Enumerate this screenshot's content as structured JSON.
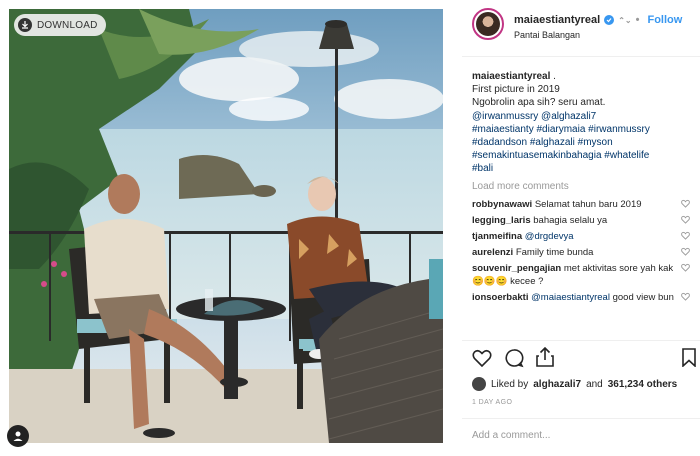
{
  "download": {
    "label": "DOWNLOAD",
    "icon": "download-icon"
  },
  "photo": {
    "alt_subject": "two men seated on a terrace overlooking the sea"
  },
  "header": {
    "username": "maiaestiantyreal",
    "follow_label": "Follow",
    "location": "Pantai Balangan",
    "verified_icon": "verified-badge-icon"
  },
  "caption": {
    "username": "maiaestiantyreal",
    "line1": "First picture in 2019",
    "line2": "Ngobrolin apa sih? seru amat.",
    "mentions": "@irwanmussry @alghazali7",
    "hashtags1": "#maiaestianty #diarymaia #irwanmussry",
    "hashtags2": "#dadandson #alghazali #myson",
    "hashtags3": "#semakintuasemakinbahagia #whatelife",
    "hashtags4": "#bali"
  },
  "load_more": "Load more comments",
  "comments": [
    {
      "user": "robbynawawi",
      "text": "Selamat tahun baru 2019"
    },
    {
      "user": "legging_laris",
      "text": "bahagia selalu ya"
    },
    {
      "user": "tjanmeifina",
      "mention": "@drgdevya",
      "text": ""
    },
    {
      "user": "aurelenzi",
      "text": "Family time bunda"
    },
    {
      "user": "souvenir_pengajian",
      "text": "met aktivitas sore yah kak 😊😊😊 kecee ?"
    },
    {
      "user": "ionsoerbakti",
      "mention": "@maiaestiantyreal",
      "text": "good view bun"
    }
  ],
  "likes": {
    "prefix": "Liked by",
    "user": "alghazali7",
    "and": "and",
    "count": "361,234 others"
  },
  "time": "1 DAY AGO",
  "add_comment_placeholder": "Add a comment...",
  "colors": {
    "link": "#003569",
    "follow": "#3897f0",
    "muted": "#999999",
    "ring": "#c13584"
  }
}
